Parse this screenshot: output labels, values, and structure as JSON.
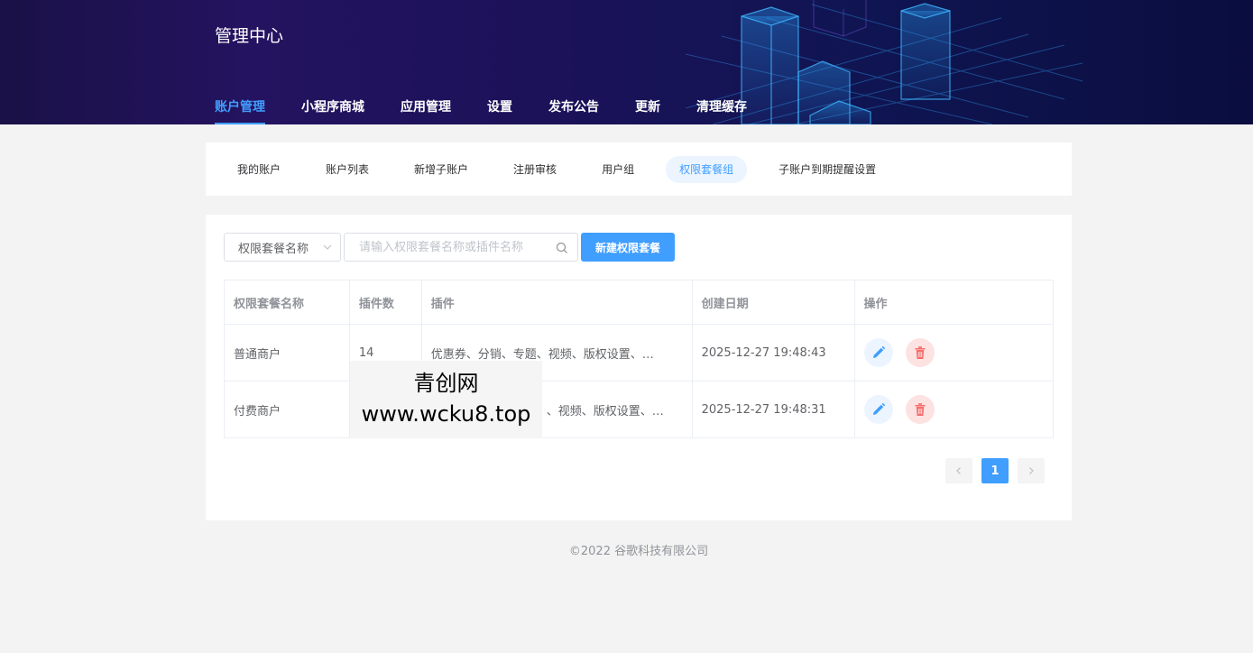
{
  "app": {
    "title": "管理中心"
  },
  "nav": {
    "items": [
      {
        "label": "账户管理",
        "active": true
      },
      {
        "label": "小程序商城"
      },
      {
        "label": "应用管理"
      },
      {
        "label": "设置"
      },
      {
        "label": "发布公告"
      },
      {
        "label": "更新"
      },
      {
        "label": "清理缓存"
      }
    ]
  },
  "tabs": {
    "items": [
      {
        "label": "我的账户"
      },
      {
        "label": "账户列表"
      },
      {
        "label": "新增子账户"
      },
      {
        "label": "注册审核"
      },
      {
        "label": "用户组"
      },
      {
        "label": "权限套餐组",
        "active": true
      },
      {
        "label": "子账户到期提醒设置"
      }
    ]
  },
  "toolbar": {
    "select_value": "权限套餐名称",
    "search_placeholder": "请输入权限套餐名称或插件名称",
    "create_label": "新建权限套餐"
  },
  "table": {
    "headers": [
      "权限套餐名称",
      "插件数",
      "插件",
      "创建日期",
      "操作"
    ],
    "rows": [
      {
        "name": "普通商户",
        "count": "14",
        "plugins": "优惠券、分销、专题、视频、版权设置、…",
        "date": "2025-12-27 19:48:43"
      },
      {
        "name": "付费商户",
        "count": "",
        "plugins": "、视频、版权设置、…",
        "date": "2025-12-27 19:48:31"
      }
    ]
  },
  "pagination": {
    "current": "1"
  },
  "footer": {
    "text": "©2022 谷歌科技有限公司"
  },
  "watermark": {
    "line1": "青创网",
    "line2": "www.wcku8.top"
  },
  "colors": {
    "primary": "#409eff",
    "danger": "#f56c6c",
    "header_bg": "#1b1259"
  },
  "icons": {
    "edit": "pencil-icon",
    "delete": "trash-icon",
    "search": "search-icon",
    "dropdown": "chevron-down-icon"
  }
}
